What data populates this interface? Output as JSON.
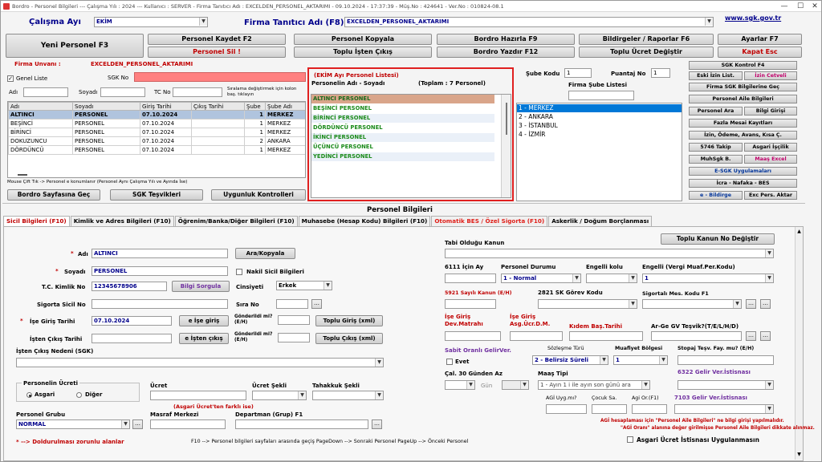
{
  "window": {
    "title": "Bordro - Personel Bilgileri  ---  Çalışma Yılı : 2024  ---  Kullanıcı : SERVER - Firma Tanıtıcı Adı : EXCELDEN_PERSONEL_AKTARIMI - 09.10.2024 - 17:37:39 - Müş.No : 424641 - Ver.No : 010824-08.1",
    "minimize": "—",
    "maximize": "☐",
    "close": "✕"
  },
  "header": {
    "calisma_ayi_label": "Çalışma Ayı",
    "calisma_ayi_value": "EKİM",
    "firma_label": "Firma Tanıtıcı Adı (F8)",
    "firma_value": "EXCELDEN_PERSONEL_AKTARIMI",
    "sgk_link": "www.sgk.gov.tr"
  },
  "toolbar": {
    "yeni_personel": "Yeni Personel F3",
    "personel_kaydet": "Personel Kaydet F2",
    "personel_sil": "Personel Sil !",
    "personel_kopyala": "Personel Kopyala",
    "toplu_isten_cikis": "Toplu İşten Çıkış",
    "bordro_hazirla": "Bordro Hazırla F9",
    "bordro_yazdir": "Bordro Yazdır F12",
    "bildirgeler": "Bildirgeler / Raporlar F6",
    "toplu_ucret": "Toplu Ücret Değiştir",
    "ayarlar": "Ayarlar F7",
    "kapat": "Kapat Esc"
  },
  "firma_unvani": {
    "label": "Firma Unvanı :",
    "value": "EXCELDEN_PERSONEL_AKTARIMI"
  },
  "filter": {
    "genel_liste": "Genel Liste",
    "sgk_no_label": "SGK No",
    "adi_label": "Adı",
    "soyadi_label": "Soyadı",
    "tc_no_label": "TC No",
    "sort_hint": "Sıralama değiştirmek için kolon baş. tıklayın"
  },
  "personel_table": {
    "columns": [
      "Adı",
      "Soyadı",
      "Giriş Tarihi",
      "Çıkış Tarihi",
      "Şube",
      "Şube Adı"
    ],
    "rows": [
      [
        "ALTINCI",
        "PERSONEL",
        "07.10.2024",
        "",
        "1",
        "MERKEZ"
      ],
      [
        "BEŞİNCİ",
        "PERSONEL",
        "07.10.2024",
        "",
        "1",
        "MERKEZ"
      ],
      [
        "BİRİNCİ",
        "PERSONEL",
        "07.10.2024",
        "",
        "1",
        "MERKEZ"
      ],
      [
        "DOKUZUNCU",
        "PERSONEL",
        "07.10.2024",
        "",
        "2",
        "ANKARA"
      ],
      [
        "DÖRDÜNCÜ",
        "PERSONEL",
        "07.10.2024",
        "",
        "1",
        "MERKEZ"
      ]
    ],
    "footer_hint": "Mouse Çift Tık -> Personel e konumlanır (Personel Aynı Çalışma Yılı ve Ayında İse)"
  },
  "list_buttons": {
    "bordro_sayfasina_gec": "Bordro Sayfasına Geç",
    "sgk_tesvikleri": "SGK Teşvikleri",
    "uygunluk_kontrolleri": "Uygunluk Kontrolleri"
  },
  "ay_personel": {
    "title": "(EKİM Ayı Personel Listesi)",
    "subtitle": "Personelin Adı - Soyadı",
    "toplam": "(Toplam : 7 Personel)",
    "items": [
      "ALTINCI PERSONEL",
      "BEŞİNCİ PERSONEL",
      "BİRİNCİ PERSONEL",
      "DÖRDÜNCÜ PERSONEL",
      "İKİNCİ PERSONEL",
      "ÜÇÜNCÜ PERSONEL",
      "YEDİNCİ PERSONEL"
    ]
  },
  "sube": {
    "sube_kodu_label": "Şube Kodu",
    "sube_kodu_value": "1",
    "puantaj_label": "Puantaj No",
    "puantaj_value": "1",
    "liste_label": "Firma Şube Listesi",
    "items": [
      "1 - MERKEZ",
      "2 - ANKARA",
      "3 - İSTANBUL",
      "4 - İZMİR"
    ]
  },
  "right_buttons": {
    "sgk_kontrol": "SGK Kontrol F4",
    "eski_izin": "Eski İzin List.",
    "izin_cetveli": "İzin Cetveli",
    "firma_sgk": "Firma SGK Bilgilerine Geç",
    "personel_aile": "Personel Aile Bilgileri",
    "personel_ara": "Personel Ara",
    "bilgi_girisi": "Bilgi Girişi",
    "fazla_mesai": "Fazla Mesai Kayıtları",
    "izin_odeme": "İzin, Ödeme, Avans, Kısa Ç.",
    "takip_5746": "5746 Takip",
    "asgari_iscilik": "Asgari İşçilik",
    "muhsgk": "MuhSgk B.",
    "maas_excel": "Maaş Excel",
    "e_sgk": "E-SGK Uygulamaları",
    "icra": "İcra - Nafaka - BES",
    "e_bildirge": "e - Bildirge",
    "exc_pers": "Exc Pers. Aktar"
  },
  "section_title": "Personel Bilgileri",
  "tabs": [
    "Sicil Bilgileri (F10)",
    "Kimlik ve Adres Bilgileri (F10)",
    "Öğrenim/Banka/Diğer Bilgileri (F10)",
    "Muhasebe (Hesap Kodu) Bilgileri (F10)",
    "Otomatik BES / Özel Sigorta (F10)",
    "Askerlik / Doğum Borçlanması"
  ],
  "form": {
    "adi_label": "Adı",
    "adi_value": "ALTINCI",
    "ara_kopyala": "Ara/Kopyala",
    "soyadi_label": "Soyadı",
    "soyadi_value": "PERSONEL",
    "nakil": "Nakil Sicil Bilgileri",
    "tc_label": "T.C. Kimlik No",
    "tc_value": "12345678906",
    "bilgi_sorgula": "Bilgi Sorgula",
    "cinsiyet_label": "Cinsiyeti",
    "cinsiyet_value": "Erkek",
    "sigorta_label": "Sigorta Sicil No",
    "sira_label": "Sıra No",
    "ise_giris_label": "İşe Giriş Tarihi",
    "ise_giris_value": "07.10.2024",
    "e_ise_giris": "e İşe giriş",
    "gonderildi1": "Gönderildi mi? (E/H)",
    "toplu_giris": "Toplu Giriş (xml)",
    "isten_cikis_label": "İşten Çıkış Tarihi",
    "e_isten_cikis": "e İşten çıkış",
    "gonderildi2": "Gönderildi mi? (E/H)",
    "toplu_cikis": "Toplu Çıkış (xml)",
    "cikis_nedeni_label": "İşten Çıkış Nedeni (SGK)",
    "ucret_box_label": "Personelin Ücreti",
    "asgari": "Asgari",
    "diger": "Diğer",
    "ucret_label": "Ücret",
    "ucret_sekli_label": "Ücret Şekli",
    "tahakkuk_label": "Tahakkuk Şekli",
    "asgari_note": "(Asgari Ücret'ten farklı ise)",
    "grup_label": "Personel Grubu",
    "grup_value": "NORMAL",
    "masraf_label": "Masraf Merkezi",
    "departman_label": "Departman (Grup) F1",
    "zorunlu_note": "* --> Doldurulması zorunlu alanlar",
    "nav_hint": "F10 --> Personel bilgileri sayfaları arasında geçiş   PageDown --> Sonraki Personel    PageUp --> Önceki Personel"
  },
  "kanun": {
    "tabi_label": "Tabi Olduğu Kanun",
    "toplu_kanun": "Toplu Kanun No Değiştir",
    "icin_ay_label": "6111 İçin Ay",
    "durum_label": "Personel Durumu",
    "durum_value": "1 - Normal",
    "engelli_kolu_label": "Engelli kolu",
    "engelli_vergi_label": "Engelli (Vergi Muaf.Per.Kodu)",
    "engelli_vergi_value": "1",
    "kanun_5921": "5921 Sayılı Kanun (E/H)",
    "gorev_kodu_label": "2821 SK Görev Kodu",
    "sigortali_mes_label": "Sigortalı Mes. Kodu F1",
    "ise_giris_dev": "İşe Giriş Dev.Matrahı",
    "ise_giris_asg": "İşe Giriş Asg.Ücr.D.M.",
    "kidem_bas": "Kıdem Baş.Tarihi",
    "arge_label": "Ar-Ge GV Teşvik?(T/E/L/H/D)",
    "sabit_oranli": "Sabit Oranlı GelirVer.",
    "evet": "Evet",
    "sozlesme_label": "Sözleşme Türü",
    "sozlesme_value": "2 - Belirsiz Süreli",
    "muafiyet_label": "Muafiyet Bölgesi",
    "muafiyet_value": "1",
    "stopaj_label": "Stopaj Teşv. Fay. mu? (E/H)",
    "cal30_label": "Çal. 30 Günden Az",
    "gun_label": "Gün",
    "maas_tipi_label": "Maaş Tipi",
    "maas_tipi_value": "1 - Ayın 1 i ile ayın son günü ara",
    "gelir_6322": "6322 Gelir Ver.İstisnası",
    "agi_uyg_label": "AGİ Uyg.mı?",
    "cocuk_label": "Çocuk Sa.",
    "agi_or_label": "Agi Or.(F1)",
    "gelir_7103": "7103 Gelir Ver.İstisnası",
    "agi_note1": "AGİ hesaplaması için \"Personel Aile Bilgileri\" ne bilgi girişi yapılmalıdır.",
    "agi_note2": "\"AGİ Oranı\" alanına değer girilmişse Personel Aile Bilgileri dikkate alınmaz.",
    "asgari_istisna": "Asgari Ücret İstisnası Uygulanmasın"
  },
  "colors": {
    "accent_red": "#c00000",
    "highlight_pink": "#ff8080",
    "selected_row": "#b0c4de",
    "list_green": "#1a8a1a",
    "list_selected_blue": "#0078d7",
    "label_blue": "#00008b",
    "purple": "#7030a0"
  }
}
